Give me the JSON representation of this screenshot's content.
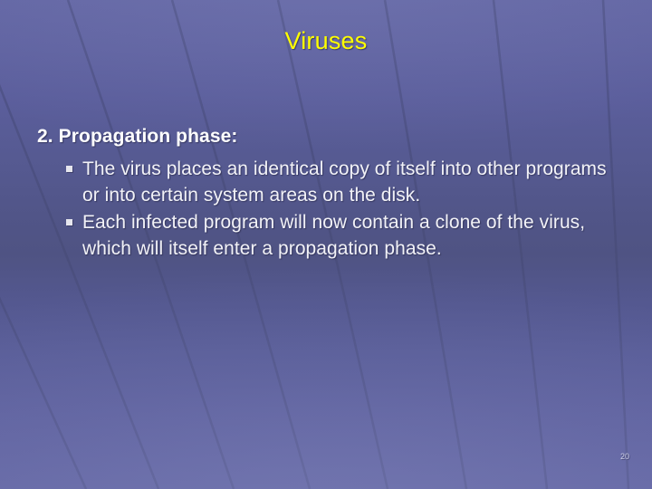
{
  "slide": {
    "title": "Viruses",
    "title_color": "#ffff00",
    "background_color_top": "#6265a3",
    "background_color_horizon": "#4f5383",
    "background_color_bottom": "#6669a6",
    "body_text_color": "#f2f2f7",
    "lead": "2. Propagation phase:",
    "bullets": [
      {
        "marker": "square-bullet",
        "text": "The virus places an identical copy of itself into other programs or into certain system areas on the disk."
      },
      {
        "marker": "square-bullet",
        "text": "Each infected program will now contain a clone of the virus, which will itself enter a propagation phase."
      }
    ],
    "page_number": "20"
  }
}
